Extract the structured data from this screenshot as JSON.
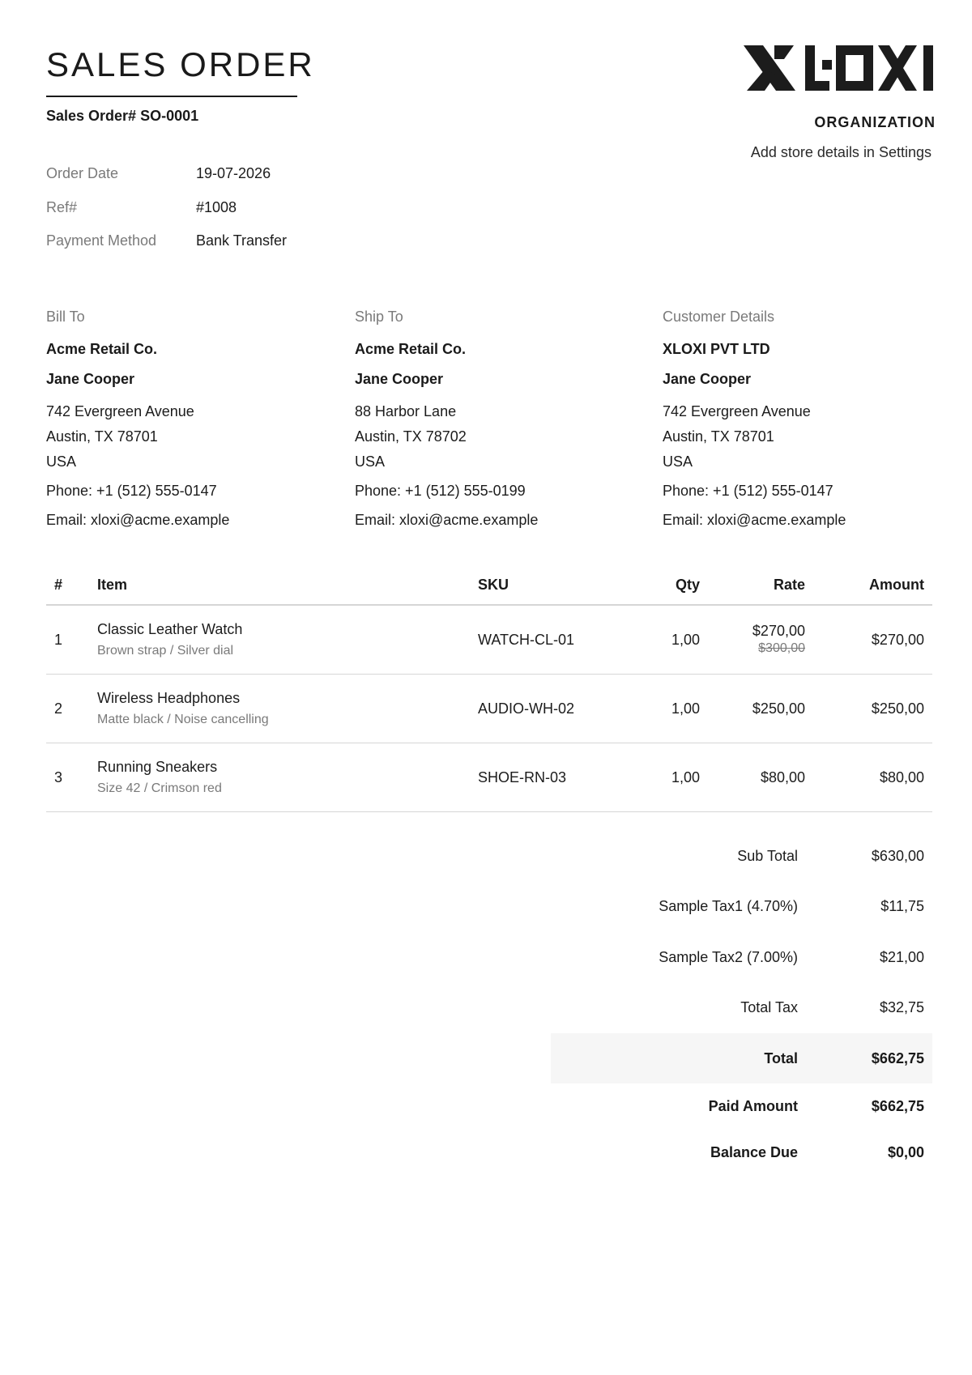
{
  "document": {
    "title": "SALES ORDER",
    "order_number": "Sales Order# SO-0001"
  },
  "organization": {
    "name": "ORGANIZATION",
    "details": "Add store details in Settings",
    "logo_text": "XLOXI"
  },
  "meta": [
    {
      "label": "Order Date",
      "value": "19-07-2026"
    },
    {
      "label": "Ref#",
      "value": "#1008"
    },
    {
      "label": "Payment Method",
      "value": "Bank Transfer"
    }
  ],
  "bill_to": {
    "heading": "Bill To",
    "company": "Acme Retail Co.",
    "contact": "Jane Cooper",
    "address1": "742 Evergreen Avenue",
    "address2": "Austin, TX 78701",
    "country": "USA",
    "phone": "Phone: +1 (512) 555-0147",
    "email": "Email: xloxi@acme.example"
  },
  "ship_to": {
    "heading": "Ship To",
    "company": "Acme Retail Co.",
    "contact": "Jane Cooper",
    "address1": "88 Harbor Lane",
    "address2": "Austin, TX 78702",
    "country": "USA",
    "phone": "Phone: +1 (512) 555-0199",
    "email": "Email: xloxi@acme.example"
  },
  "customer": {
    "heading": "Customer Details",
    "company": "XLOXI PVT LTD",
    "contact": "Jane Cooper",
    "address1": "742 Evergreen Avenue",
    "address2": "Austin, TX 78701",
    "country": "USA",
    "phone": "Phone: +1 (512) 555-0147",
    "email": "Email: xloxi@acme.example"
  },
  "table": {
    "headers": {
      "num": "#",
      "item": "Item",
      "sku": "SKU",
      "qty": "Qty",
      "rate": "Rate",
      "amount": "Amount"
    },
    "rows": [
      {
        "num": "1",
        "name": "Classic Leather Watch",
        "desc": "Brown strap / Silver dial",
        "sku": "WATCH-CL-01",
        "qty": "1,00",
        "rate": "$270,00",
        "old_rate": "$300,00",
        "amount": "$270,00"
      },
      {
        "num": "2",
        "name": "Wireless Headphones",
        "desc": "Matte black / Noise cancelling",
        "sku": "AUDIO-WH-02",
        "qty": "1,00",
        "rate": "$250,00",
        "old_rate": "",
        "amount": "$250,00"
      },
      {
        "num": "3",
        "name": "Running Sneakers",
        "desc": "Size 42 / Crimson red",
        "sku": "SHOE-RN-03",
        "qty": "1,00",
        "rate": "$80,00",
        "old_rate": "",
        "amount": "$80,00"
      }
    ]
  },
  "totals": {
    "sub_total": {
      "label": "Sub Total",
      "value": "$630,00"
    },
    "tax1": {
      "label": "Sample Tax1 (4.70%)",
      "value": "$11,75"
    },
    "tax2": {
      "label": "Sample Tax2 (7.00%)",
      "value": "$21,00"
    },
    "total_tax": {
      "label": "Total Tax",
      "value": "$32,75"
    },
    "total": {
      "label": "Total",
      "value": "$662,75"
    },
    "paid": {
      "label": "Paid Amount",
      "value": "$662,75"
    },
    "balance": {
      "label": "Balance Due",
      "value": "$0,00"
    }
  }
}
